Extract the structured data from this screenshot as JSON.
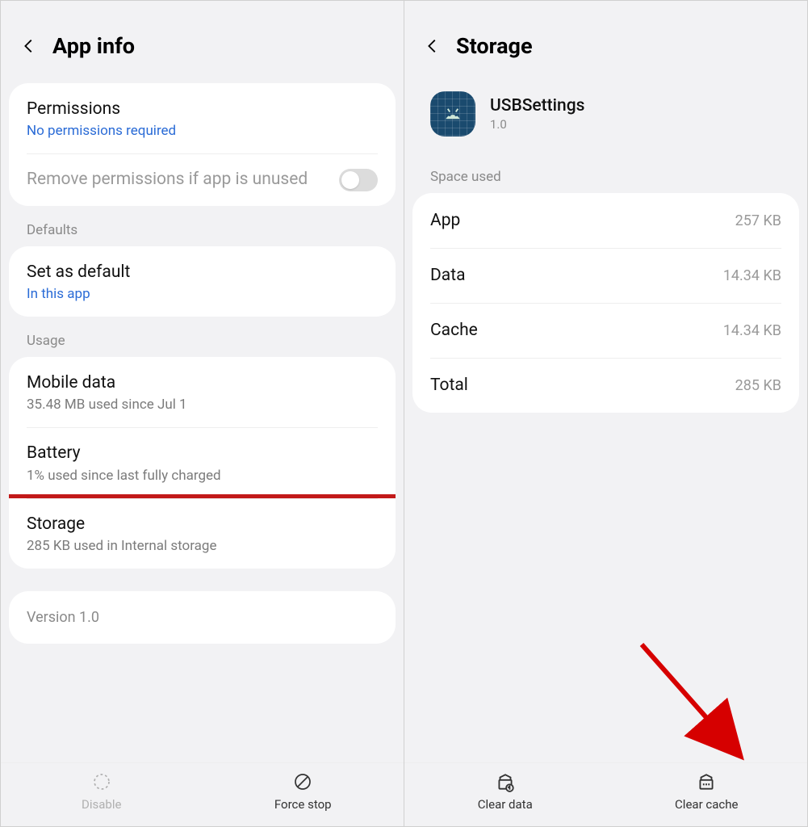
{
  "left": {
    "title": "App info",
    "permissions": {
      "label": "Permissions",
      "sub": "No permissions required"
    },
    "remove_perms": "Remove permissions if app is unused",
    "sections": {
      "defaults": "Defaults",
      "usage": "Usage"
    },
    "set_default": {
      "label": "Set as default",
      "sub": "In this app"
    },
    "mobile_data": {
      "label": "Mobile data",
      "sub": "35.48 MB used since Jul 1"
    },
    "battery": {
      "label": "Battery",
      "sub": "1% used since last fully charged"
    },
    "storage": {
      "label": "Storage",
      "sub": "285 KB used in Internal storage"
    },
    "version": "Version 1.0",
    "buttons": {
      "disable": "Disable",
      "force_stop": "Force stop"
    }
  },
  "right": {
    "title": "Storage",
    "app": {
      "name": "USBSettings",
      "version": "1.0"
    },
    "space_label": "Space used",
    "rows": {
      "app": {
        "key": "App",
        "val": "257 KB"
      },
      "data": {
        "key": "Data",
        "val": "14.34 KB"
      },
      "cache": {
        "key": "Cache",
        "val": "14.34 KB"
      },
      "total": {
        "key": "Total",
        "val": "285 KB"
      }
    },
    "buttons": {
      "clear_data": "Clear data",
      "clear_cache": "Clear cache"
    }
  }
}
